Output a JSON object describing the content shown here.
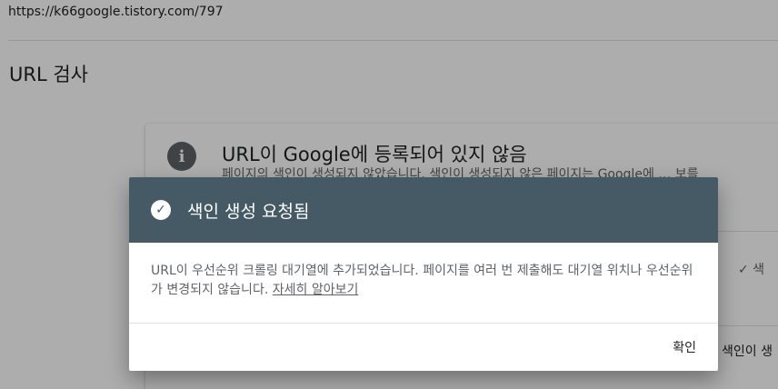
{
  "header": {
    "url": "https://k66google.tistory.com/797",
    "title": "URL 검사"
  },
  "card": {
    "title": "URL이 Google에 등록되어 있지 않음",
    "description": "페이지의 색인이 생성되지 않았습니다. 색인이 생성되지 않은 페이지는 Google에 … 보를",
    "status_label": "✓ 색",
    "index_label": "색인이 생"
  },
  "dialog": {
    "title": "색인 생성 요청됨",
    "body": "URL이 우선순위 크롤링 대기열에 추가되었습니다. 페이지를 여러 번 제출해도 대기열 위치나 우선순위가 변경되지 않습니다. ",
    "link_label": "자세히 알아보기",
    "ok_label": "확인"
  },
  "colors": {
    "dialog_header": "#455a64",
    "scrim": "rgba(0,0,0,0.32)"
  }
}
